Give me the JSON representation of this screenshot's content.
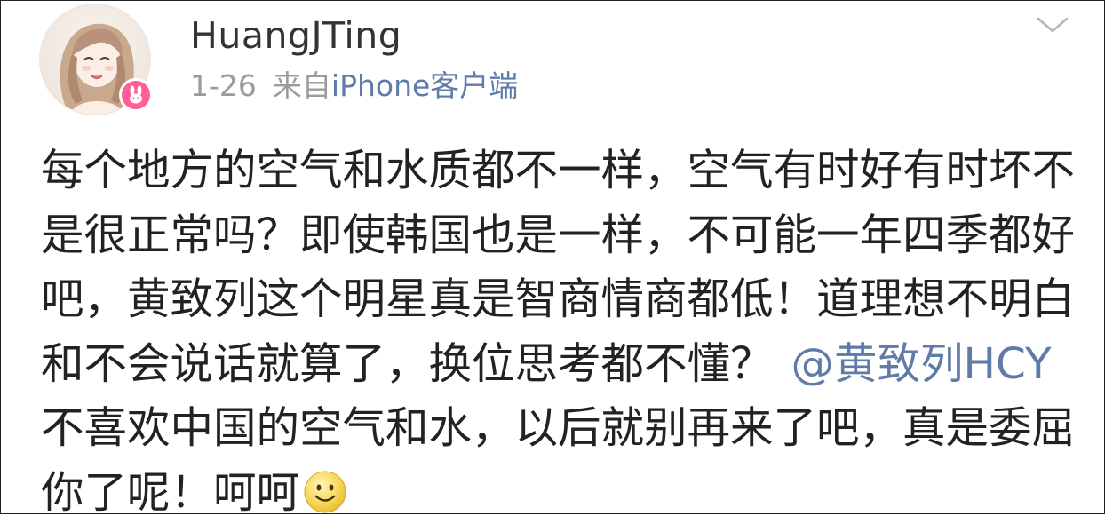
{
  "post": {
    "username": "HuangJTing",
    "date": "1-26",
    "from_label": "来自",
    "client": "iPhone客户端",
    "lines": [
      "每个地方的空气和水质都不一样，空气有时好有时坏不",
      "是很正常吗？即使韩国也是一样，不可能一年四季都好",
      "吧，黄致列这个明星真是智商情商都低！道理想不明白"
    ],
    "line4_text": "和不会说话就算了，换位思考都不懂？",
    "mention": "@黄致列HCY",
    "line5": "不喜欢中国的空气和水，以后就别再来了吧，真是委屈",
    "line6_text": "你了呢！呵呵",
    "emoji_icon": "smile-emoji"
  },
  "icons": {
    "badge": "bunny-badge-icon",
    "menu": "chevron-down-icon"
  },
  "colors": {
    "link": "#5f7ba8",
    "meta": "#9b9b9b",
    "text": "#222222",
    "badge": "#ff5f98"
  }
}
